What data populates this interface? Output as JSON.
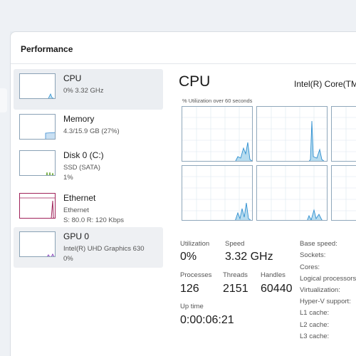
{
  "window": {
    "title": "Performance"
  },
  "sidebar": {
    "items": [
      {
        "name": "CPU",
        "line1": "0%  3.32 GHz",
        "line2": "",
        "line3": ""
      },
      {
        "name": "Memory",
        "line1": "4.3/15.9 GB (27%)",
        "line2": "",
        "line3": ""
      },
      {
        "name": "Disk 0 (C:)",
        "line1": "SSD (SATA)",
        "line2": "1%",
        "line3": ""
      },
      {
        "name": "Ethernet",
        "line1": "Ethernet",
        "line2": "S: 80.0  R: 120 Kbps",
        "line3": ""
      },
      {
        "name": "GPU 0",
        "line1": "Intel(R) UHD Graphics 630",
        "line2": "0%",
        "line3": ""
      }
    ]
  },
  "main": {
    "title": "CPU",
    "model": "Intel(R) Core(TM",
    "graph_label": "% Utilization over 60 seconds"
  },
  "stats": {
    "utilization": {
      "label": "Utilization",
      "value": "0%"
    },
    "speed": {
      "label": "Speed",
      "value": "3.32 GHz"
    },
    "processes": {
      "label": "Processes",
      "value": "126"
    },
    "threads": {
      "label": "Threads",
      "value": "2151"
    },
    "handles": {
      "label": "Handles",
      "value": "60440"
    },
    "uptime": {
      "label": "Up time",
      "value": "0:00:06:21"
    }
  },
  "specs": [
    {
      "label": "Base speed:"
    },
    {
      "label": "Sockets:"
    },
    {
      "label": "Cores:"
    },
    {
      "label": "Logical processors:"
    },
    {
      "label": "Virtualization:"
    },
    {
      "label": "Hyper-V support:"
    },
    {
      "label": "L1 cache:"
    },
    {
      "label": "L2 cache:"
    },
    {
      "label": "L3 cache:"
    }
  ],
  "colors": {
    "cpu_accent": "#2f8fd0",
    "cpu_fill": "#b7dcef",
    "memory_accent": "#3c8cd0",
    "disk_accent": "#6ea83a",
    "ethernet_accent": "#a0235a",
    "gpu_accent": "#8844bb"
  }
}
